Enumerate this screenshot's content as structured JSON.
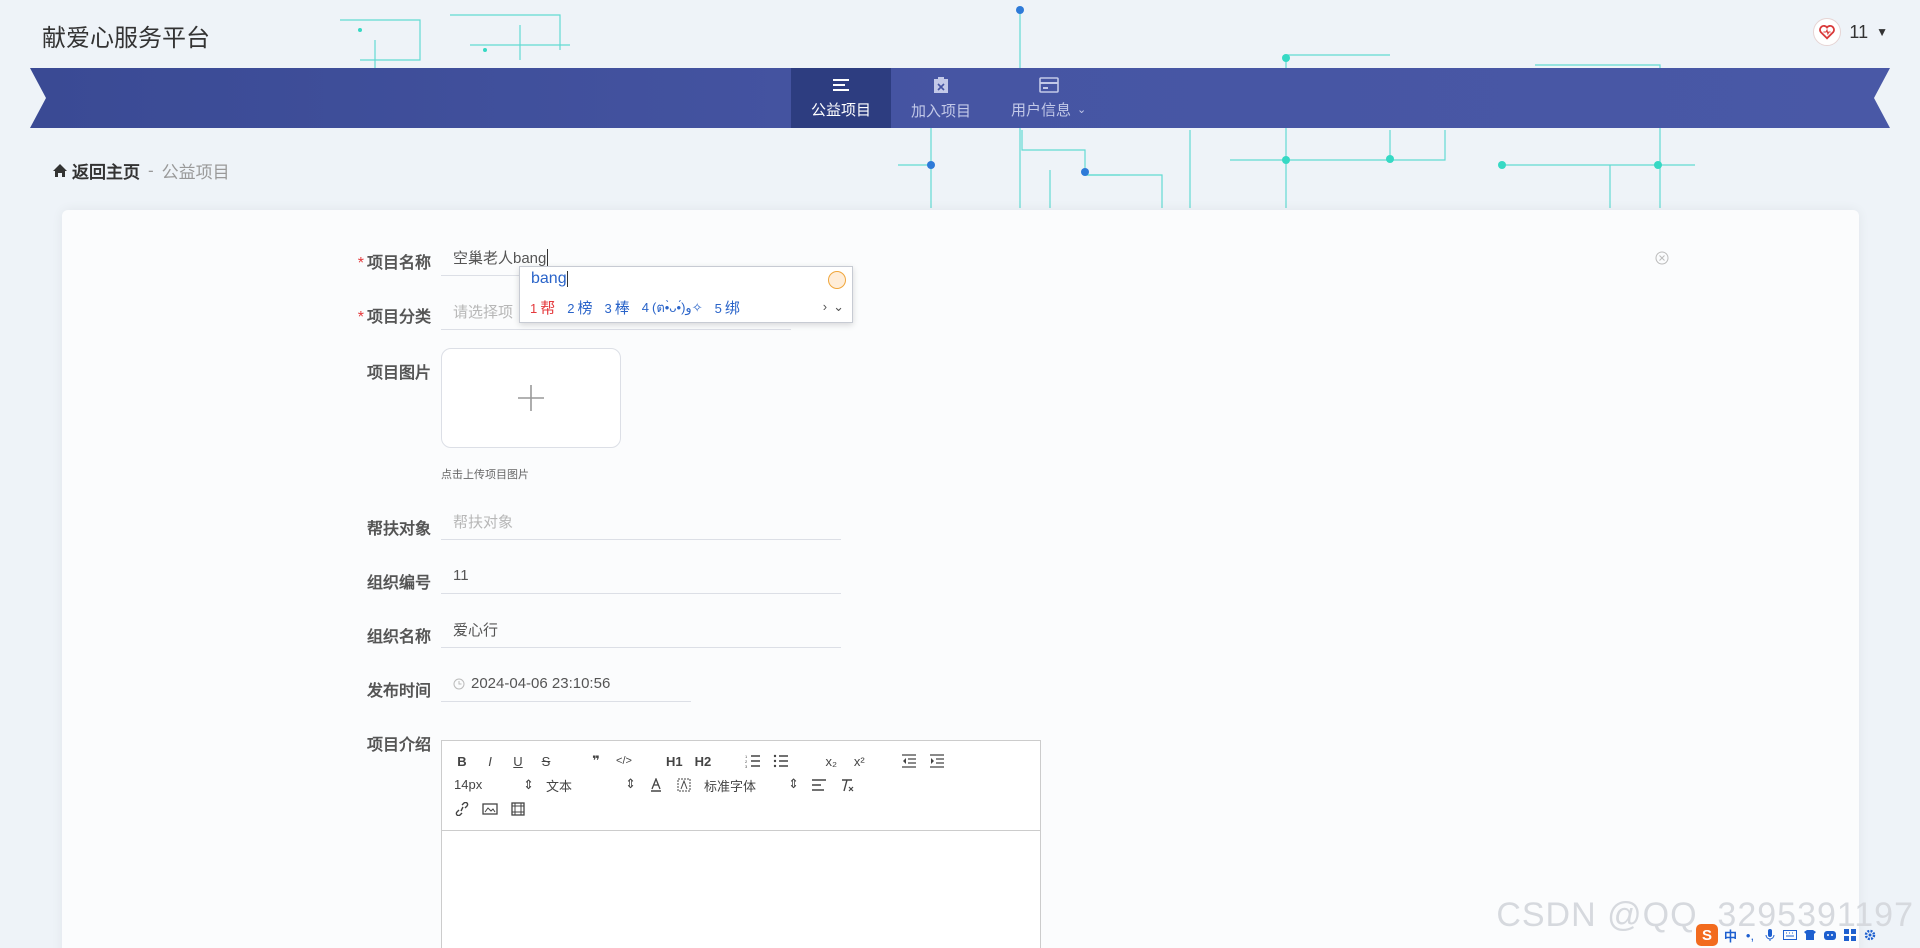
{
  "site": {
    "title": "献爱心服务平台"
  },
  "user": {
    "name": "11",
    "avatar_icon": "heart-logo-icon"
  },
  "nav": {
    "items": [
      {
        "label": "公益项目",
        "icon": "list-icon",
        "active": true
      },
      {
        "label": "加入项目",
        "icon": "clipboard-icon",
        "active": false
      },
      {
        "label": "用户信息",
        "icon": "card-icon",
        "active": false,
        "has_dropdown": true
      }
    ]
  },
  "breadcrumb": {
    "home": "返回主页",
    "separator": "-",
    "current": "公益项目"
  },
  "form": {
    "project_name": {
      "label": "项目名称",
      "required": true,
      "value": "空巢老人bang"
    },
    "project_category": {
      "label": "项目分类",
      "required": true,
      "placeholder": "请选择项目分类",
      "visible_placeholder": "请选择项"
    },
    "project_image": {
      "label": "项目图片",
      "hint": "点击上传项目图片"
    },
    "help_target": {
      "label": "帮扶对象",
      "placeholder": "帮扶对象"
    },
    "org_id": {
      "label": "组织编号",
      "value": "11"
    },
    "org_name": {
      "label": "组织名称",
      "value": "爱心行"
    },
    "publish_time": {
      "label": "发布时间",
      "value": "2024-04-06 23:10:56"
    },
    "intro": {
      "label": "项目介绍",
      "toolbar": {
        "font_size": "14px",
        "header": "文本",
        "font_family": "标准字体",
        "buttons_row1": [
          "B",
          "I",
          "U",
          "S",
          "❞",
          "</>",
          "H1",
          "H2",
          "ol",
          "ul",
          "x₂",
          "x²",
          "outdent",
          "indent"
        ],
        "buttons_row3": [
          "link",
          "image",
          "video"
        ]
      }
    }
  },
  "ime": {
    "composition": "bang",
    "candidates": [
      {
        "n": "1",
        "text": "帮"
      },
      {
        "n": "2",
        "text": "榜"
      },
      {
        "n": "3",
        "text": "棒"
      },
      {
        "n": "4",
        "text": "(ต•̀ᴗ•́)و✧"
      },
      {
        "n": "5",
        "text": "绑"
      }
    ]
  },
  "watermark": "CSDN @QQ_3295391197",
  "tray": {
    "lang": "中"
  },
  "colors": {
    "nav_bg": "#3e4f9a",
    "nav_active": "#2d3d80",
    "required": "#e4393c",
    "circuit": "#3fd9c8"
  }
}
